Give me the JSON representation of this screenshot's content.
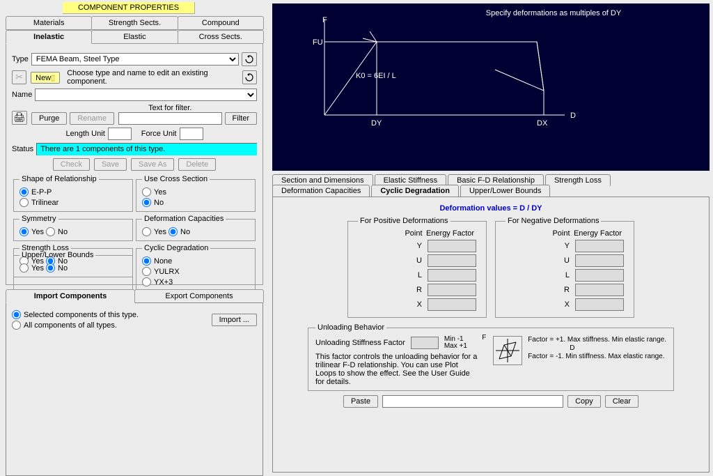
{
  "title": "COMPONENT PROPERTIES",
  "upper_tabs": {
    "row1": [
      "Materials",
      "Strength Sects.",
      "Compound"
    ],
    "row2": [
      "Inelastic",
      "Elastic",
      "Cross Sects."
    ],
    "active": "Inelastic"
  },
  "type_label": "Type",
  "type_value": "FEMA Beam, Steel Type",
  "new_btn": "New",
  "choose_text": "Choose type and name to edit an existing component.",
  "name_label": "Name",
  "name_value": "",
  "text_for_filter": "Text for filter.",
  "purge": "Purge",
  "rename": "Rename",
  "filter": "Filter",
  "length_unit": "Length Unit",
  "force_unit": "Force Unit",
  "status_label": "Status",
  "status_text": "There are 1 components of this type.",
  "check": "Check",
  "save": "Save",
  "saveas": "Save As",
  "delete": "Delete",
  "shape_legend": "Shape of Relationship",
  "shape_opts": [
    "E-P-P",
    "Trilinear"
  ],
  "usecs_legend": "Use Cross Section",
  "yes": "Yes",
  "no": "No",
  "symmetry_legend": "Symmetry",
  "defcap_legend": "Deformation Capacities",
  "strloss_legend": "Strength Loss",
  "cycdeg_legend": "Cyclic Degradation",
  "cycdeg_opts": [
    "None",
    "YULRX",
    "YX+3"
  ],
  "ulb_legend": "Upper/Lower Bounds",
  "import_tabs": [
    "Import Components",
    "Export Components"
  ],
  "imp_sel": "Selected components of this type.",
  "imp_all": "All components of all types.",
  "import_btn": "Import ...",
  "chart_title": "Specify deformations as multiples of DY",
  "chart_F": "F",
  "chart_FU": "FU",
  "chart_K0": "K0 = 6EI / L",
  "chart_DY": "DY",
  "chart_DX": "DX",
  "chart_D": "D",
  "lower_tabs_row1": [
    "Section and Dimensions",
    "Elastic Stiffness",
    "Basic F-D Relationship",
    "Strength Loss"
  ],
  "lower_tabs_row2": [
    "Deformation Capacities",
    "Cyclic Degradation",
    "Upper/Lower Bounds"
  ],
  "lower_active": "Cyclic Degradation",
  "defvals": "Deformation values = D / DY",
  "pos_legend": "For Positive Deformations",
  "neg_legend": "For Negative Deformations",
  "col_point": "Point",
  "col_ef": "Energy Factor",
  "points": [
    "Y",
    "U",
    "L",
    "R",
    "X"
  ],
  "unload_legend": "Unloading Behavior",
  "unload_factor": "Unloading Stiffness Factor",
  "min": "Min -1",
  "max": "Max +1",
  "unload_desc": "This factor controls the unloading behavior for a trilinear F-D relationship. You can use Plot Loops to show the effect. See the User Guide for details.",
  "flabel": "F",
  "dlabel": "D",
  "f1": "Factor = +1. Max stiffness. Min elastic range.",
  "f2": "Factor = -1. Min stiffness. Max elastic range.",
  "paste": "Paste",
  "copy": "Copy",
  "clear": "Clear"
}
